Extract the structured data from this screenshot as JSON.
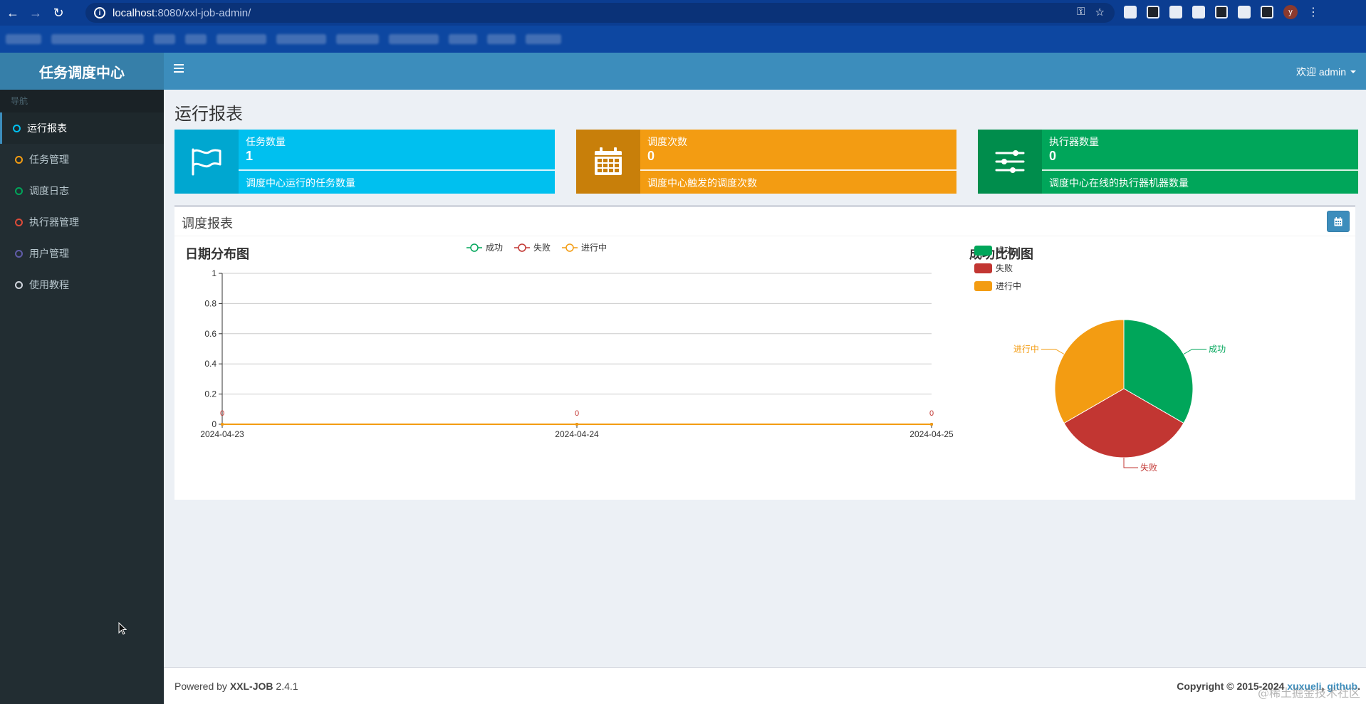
{
  "browser": {
    "url_host": "localhost",
    "url_path": ":8080/xxl-job-admin/",
    "avatar_letter": "y"
  },
  "app": {
    "logo": "任务调度中心",
    "user_menu": "欢迎 admin"
  },
  "sidebar": {
    "header": "导航",
    "items": [
      {
        "label": "运行报表",
        "color": "#00c0ef"
      },
      {
        "label": "任务管理",
        "color": "#f39c12"
      },
      {
        "label": "调度日志",
        "color": "#00a65a"
      },
      {
        "label": "执行器管理",
        "color": "#dd4b39"
      },
      {
        "label": "用户管理",
        "color": "#605ca8"
      },
      {
        "label": "使用教程",
        "color": "#d2d6de"
      }
    ]
  },
  "page": {
    "title": "运行报表"
  },
  "info_boxes": [
    {
      "label": "任务数量",
      "number": "1",
      "desc": "调度中心运行的任务数量",
      "icon": "flag-icon",
      "color": "#00c0ef",
      "icon_bg": "#00a7d0"
    },
    {
      "label": "调度次数",
      "number": "0",
      "desc": "调度中心触发的调度次数",
      "icon": "calendar-icon",
      "color": "#f39c12",
      "icon_bg": "#c87f0a"
    },
    {
      "label": "执行器数量",
      "number": "0",
      "desc": "调度中心在线的执行器机器数量",
      "icon": "sliders-icon",
      "color": "#00a65a",
      "icon_bg": "#008d4c"
    }
  ],
  "report": {
    "title": "调度报表"
  },
  "chart_data": [
    {
      "type": "line",
      "title": "日期分布图",
      "x": [
        "2024-04-23",
        "2024-04-24",
        "2024-04-25"
      ],
      "ylim": [
        0,
        1
      ],
      "yticks": [
        "0",
        "0.2",
        "0.4",
        "0.6",
        "0.8",
        "1"
      ],
      "grid": true,
      "legend_position": "top",
      "series": [
        {
          "name": "成功",
          "values": [
            0,
            0,
            0
          ],
          "color": "#00a65a"
        },
        {
          "name": "失败",
          "values": [
            0,
            0,
            0
          ],
          "color": "#c23632"
        },
        {
          "name": "进行中",
          "values": [
            0,
            0,
            0
          ],
          "color": "#f39c12"
        }
      ],
      "data_labels": [
        "0",
        "0",
        "0"
      ]
    },
    {
      "type": "pie",
      "title": "成功比例图",
      "legend_position": "top-left",
      "slices": [
        {
          "name": "成功",
          "value": 1,
          "color": "#00a65a"
        },
        {
          "name": "失败",
          "value": 1,
          "color": "#c23632"
        },
        {
          "name": "进行中",
          "value": 1,
          "color": "#f39c12"
        }
      ]
    }
  ],
  "footer": {
    "powered_prefix": "Powered by ",
    "brand": "XXL-JOB",
    "version": " 2.4.1",
    "copyright": "Copyright © 2015-2024 ",
    "link1": "xuxueli",
    "link2": "github",
    "watermark": "@稀土掘金技术社区"
  }
}
